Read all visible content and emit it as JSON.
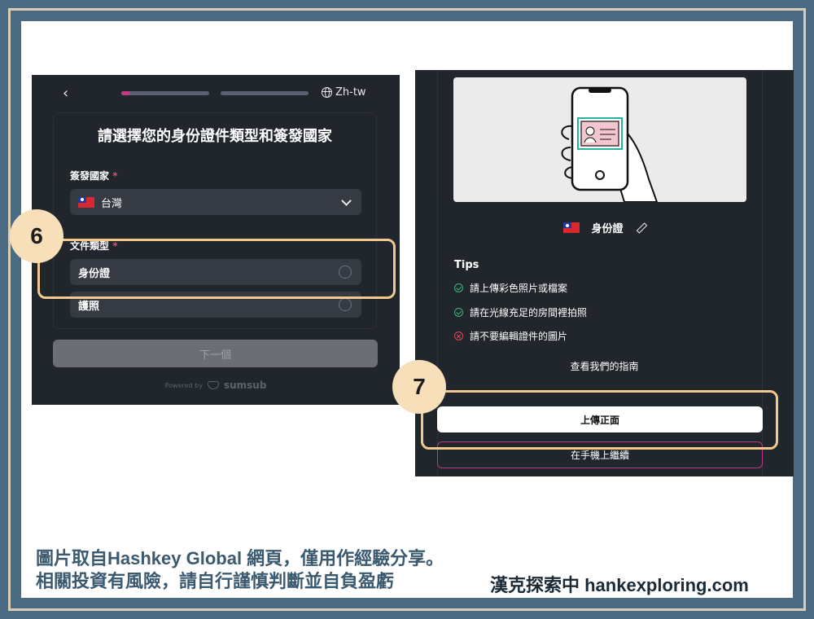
{
  "left_screen": {
    "back_icon": "chevron-left-icon",
    "progress": [
      {
        "fill_fraction": 0.1
      },
      {
        "fill_fraction": 0.0
      }
    ],
    "language": "Zh-tw",
    "language_icon": "globe-icon",
    "title": "請選擇您的身份證件類型和簽發國家",
    "country_label": "簽發國家",
    "required_mark": "*",
    "country_value": "台灣",
    "doc_type_label": "文件類型",
    "doc_options": [
      "身份證",
      "護照"
    ],
    "next_label": "下一個",
    "powered_by": "Powered by",
    "powered_brand": "sumsub"
  },
  "right_screen": {
    "doc_name": "身份證",
    "tips_title": "Tips",
    "tips": [
      {
        "text": "請上傳彩色照片或檔案",
        "status": "ok"
      },
      {
        "text": "請在光線充足的房間裡拍照",
        "status": "ok"
      },
      {
        "text": "請不要編輯證件的圖片",
        "status": "bad"
      }
    ],
    "guide_link": "查看我們的指南",
    "upload_label": "上傳正面",
    "phone_label": "在手機上繼續"
  },
  "annotations": {
    "step6": "6",
    "step7": "7"
  },
  "caption": {
    "line1": "圖片取自Hashkey Global 網頁，僅用作經驗分享。",
    "line2": "相關投資有風險，請自行謹慎判斷並自負盈虧",
    "brand": "漢克探索中 hankexploring.com"
  },
  "colors": {
    "panel_bg": "#21252c",
    "accent_pink": "#c43a87",
    "highlight": "#f1c98f",
    "badge": "#f7dfb9",
    "frame": "#4a6b82"
  }
}
